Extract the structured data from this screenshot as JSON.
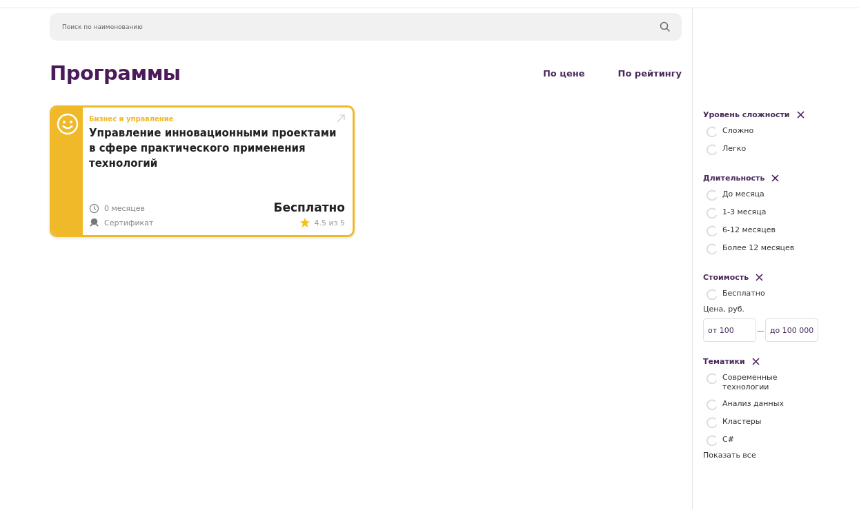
{
  "search": {
    "placeholder": "Поиск по наименованию"
  },
  "heading": "Программы",
  "sort": [
    {
      "label": "По цене",
      "selected": false
    },
    {
      "label": "По рейтингу",
      "selected": false
    }
  ],
  "cards": [
    {
      "category": "Бизнес и управление",
      "title": "Управление инновационными проектами в сфере практического применения технологий",
      "duration": "0 месяцев",
      "certificate": "Сертификат",
      "price": "Бесплатно",
      "rating": "4.5 из 5"
    }
  ],
  "filters": [
    {
      "title": "Уровень сложности",
      "options": [
        {
          "label": "Сложно",
          "selected": false
        },
        {
          "label": "Легко",
          "selected": false
        }
      ]
    },
    {
      "title": "Длительность",
      "options": [
        {
          "label": "До месяца",
          "selected": false
        },
        {
          "label": "1-3 месяца",
          "selected": false
        },
        {
          "label": "6-12 месяцев",
          "selected": false
        },
        {
          "label": "Более 12 месяцев",
          "selected": false
        }
      ]
    },
    {
      "title": "Стоимость",
      "options": [
        {
          "label": "Бесплатно",
          "selected": false
        }
      ],
      "price": {
        "label": "Цена, руб.",
        "from": "от 100",
        "separator": "—",
        "to": "до 100 000"
      }
    },
    {
      "title": "Тематики",
      "options": [
        {
          "label": "Современные технологии",
          "selected": false
        },
        {
          "label": "Анализ данных",
          "selected": false
        },
        {
          "label": "Кластеры",
          "selected": false
        },
        {
          "label": "C#",
          "selected": false
        }
      ],
      "more": "Показать все"
    }
  ]
}
